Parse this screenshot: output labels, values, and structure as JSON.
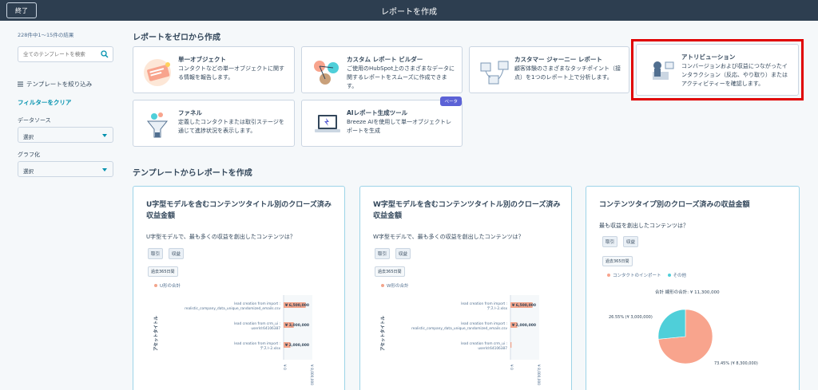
{
  "topbar": {
    "exit_label": "終了",
    "title": "レポートを作成"
  },
  "sidebar": {
    "result_count": "228件中1〜15件の結果",
    "search_placeholder": "全てのテンプレートを検索",
    "filter_head": "テンプレートを絞り込み",
    "filter_clear": "フィルターをクリア",
    "data_source_label": "データソース",
    "data_source_value": "選択",
    "chart_label": "グラフ化",
    "chart_value": "選択"
  },
  "main": {
    "section_scratch": "レポートをゼロから作成",
    "section_template": "テンプレートからレポートを作成",
    "scratch_cards": [
      {
        "title": "単一オブジェクト",
        "desc": "コンタクトなどの単一オブジェクトに関する情報を報告します。"
      },
      {
        "title": "カスタム レポート ビルダー",
        "desc": "ご使用のHubSpot上のさまざまなデータに関するレポートをスムーズに作成できます。"
      },
      {
        "title": "カスタマー ジャーニー レポート",
        "desc": "顧客体験のさまざまなタッチポイント（接点）を1つのレポート上で分析します。"
      },
      {
        "title": "アトリビューション",
        "desc": "コンバージョンおよび収益につながったインタラクション（反応、やり取り）またはアクティビティーを確認します。"
      },
      {
        "title": "ファネル",
        "desc": "定義したコンタクトまたは取引ステージを通じて進捗状況を表示します。"
      },
      {
        "title": "AIレポート生成ツール",
        "desc": "Breeze AIを使用して単一オブジェクトレポートを生成",
        "badge": "ベータ"
      }
    ],
    "templates": [
      {
        "title": "U字型モデルを含むコンテンツタイトル別のクローズ済み収益金額",
        "subtitle": "U字型モデルで、最も多くの収益を創出したコンテンツは？",
        "tags": [
          "取引",
          "収益"
        ],
        "range": "過去365日間",
        "legend": "U形の合計"
      },
      {
        "title": "W字型モデルを含むコンテンツタイトル別のクローズ済み収益金額",
        "subtitle": "W字型モデルで、最も多くの収益を創出したコンテンツは？",
        "tags": [
          "取引",
          "収益"
        ],
        "range": "過去365日間",
        "legend": "W形の合計"
      },
      {
        "title": "コンテンツタイプ別のクローズ済みの収益金額",
        "subtitle": "最も収益を創出したコンテンツは？",
        "tags": [
          "取引",
          "収益"
        ],
        "range": "過去365日間",
        "legend_items": [
          "コンタクトのインポート",
          "その他"
        ],
        "total_label": "合計 線形の合計: ¥ 11,300,000"
      }
    ]
  },
  "chart_data": [
    {
      "type": "bar",
      "orientation": "horizontal",
      "ylabel": "アセットタイトル",
      "categories": [
        "lead creation from import : realistic_company_data_unique_randomized_emails.csv",
        "lead creation from crm_ui : userId:64106387",
        "lead creation from import : テスト2.xlsx"
      ],
      "category_lines": [
        [
          "lead creation from import :",
          "realistic_company_data_unique_randomized_emails.csv"
        ],
        [
          "lead creation from crm_ui :",
          "userId:64106387"
        ],
        [
          "lead creation from import :",
          "テスト2.xlsx"
        ]
      ],
      "values": [
        6500000,
        3000000,
        2000000
      ],
      "value_labels": [
        "¥ 6,500,000",
        "¥ 3,000,000",
        "¥ 2,000,000"
      ],
      "xlim": [
        0,
        8000000
      ],
      "xtick_labels": [
        "¥ 0",
        "¥ 8,000,000"
      ],
      "color": "#f2a58c"
    },
    {
      "type": "bar",
      "orientation": "horizontal",
      "ylabel": "アセットタイトル",
      "categories": [
        "lead creation from import : テスト2.xlsx",
        "lead creation from import : realistic_company_data_unique_randomized_emails.csv",
        "lead creation from crm_ui : userId:64106387"
      ],
      "category_lines": [
        [
          "lead creation from import :",
          "テスト2.xlsx"
        ],
        [
          "lead creation from import :",
          "realistic_company_data_unique_randomized_emails.csv"
        ],
        [
          "lead creation from crm_ui :",
          "userId:64106387"
        ]
      ],
      "values": [
        6500000,
        2000000,
        300000
      ],
      "value_labels": [
        "¥ 6,500,000",
        "¥ 2,000,000",
        ""
      ],
      "xlim": [
        0,
        8000000
      ],
      "xtick_labels": [
        "¥ 0",
        "¥ 8,000,000"
      ],
      "color": "#f2a58c"
    },
    {
      "type": "pie",
      "slices": [
        {
          "name": "コンタクトのインポート",
          "value": 8300000,
          "percent": 73.45,
          "label": "73.45% (¥ 8,300,000)",
          "color": "#f8a48d"
        },
        {
          "name": "その他",
          "value": 3000000,
          "percent": 26.55,
          "label": "26.55% (¥ 3,000,000)",
          "color": "#4fcfd9"
        }
      ]
    }
  ]
}
